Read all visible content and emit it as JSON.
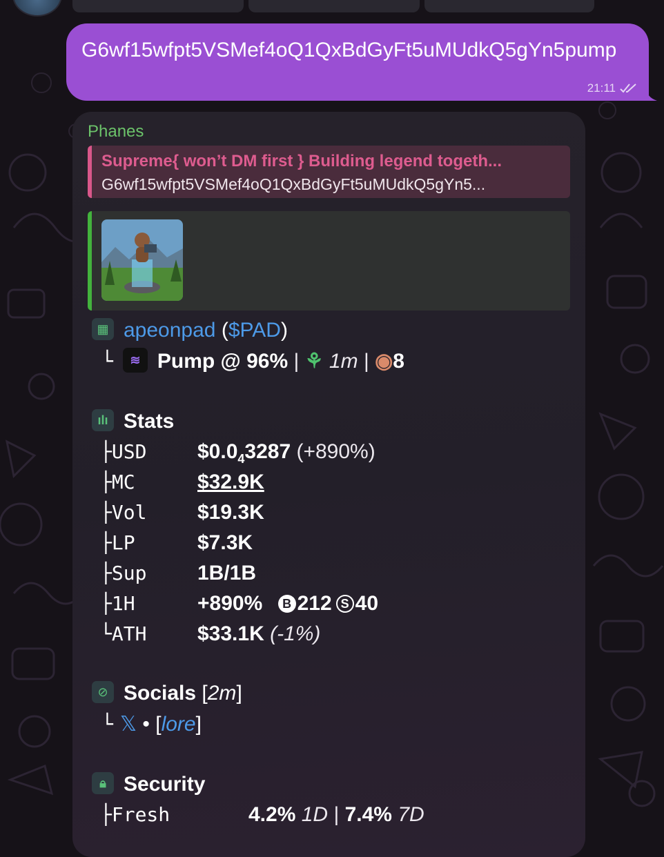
{
  "outgoing": {
    "text": "G6wf15wfpt5VSMef4oQ1QxBdGyFt5uMUdkQ5gYn5pump",
    "time": "21:11",
    "status_icon": "double-check-icon"
  },
  "card": {
    "sender": "Phanes",
    "reply": {
      "name": "Supreme{ won’t DM first } Building legend togeth...",
      "text": "G6wf15wfpt5VSMef4oQ1QxBdGyFt5uMUdkQ5gYn5..."
    },
    "token": {
      "name": "apeonpad",
      "open_paren": "(",
      "ticker": "$PAD",
      "close_paren": ")",
      "tree": "└",
      "platform": "Pump @ 96%",
      "sep": "|",
      "age": "1m",
      "views": "8"
    },
    "stats": {
      "title": "Stats",
      "rows": [
        {
          "branch": "├",
          "label": "USD",
          "value_main": "$0.0",
          "value_sub": "4",
          "value_rest": "3287",
          "extra": " (+890%)"
        },
        {
          "branch": "├",
          "label": "MC",
          "value": "$32.9K"
        },
        {
          "branch": "├",
          "label": "Vol",
          "value": "$19.3K"
        },
        {
          "branch": "├",
          "label": "LP",
          "value": "$7.3K"
        },
        {
          "branch": "├",
          "label": "Sup",
          "value": "1B/1B"
        },
        {
          "branch": "├",
          "label": "1H",
          "value": "+890%",
          "buys": "212",
          "sells": "40",
          "buy_glyph": "B",
          "sell_glyph": "S"
        },
        {
          "branch": "└",
          "label": "ATH",
          "value": "$33.1K",
          "extra": "(-1%)"
        }
      ]
    },
    "socials": {
      "title": "Socials",
      "open_bracket": "[",
      "age": "2m",
      "close_bracket": "]",
      "tree": "└",
      "x_icon": "𝕏",
      "dot": "•",
      "lore": "lore"
    },
    "security": {
      "title": "Security",
      "branch": "├",
      "label": "Fresh",
      "d1_value": "4.2%",
      "d1_label": "1D",
      "sep": "|",
      "d7_value": "7.4%",
      "d7_label": "7D"
    }
  },
  "colors": {
    "outgoing_bubble": "#9a4fd3",
    "card_bg": "#26222b",
    "sender": "#6cc36a",
    "reply_accent": "#de5c8f",
    "link": "#4d9ae8",
    "preview_accent": "#43b33d"
  }
}
